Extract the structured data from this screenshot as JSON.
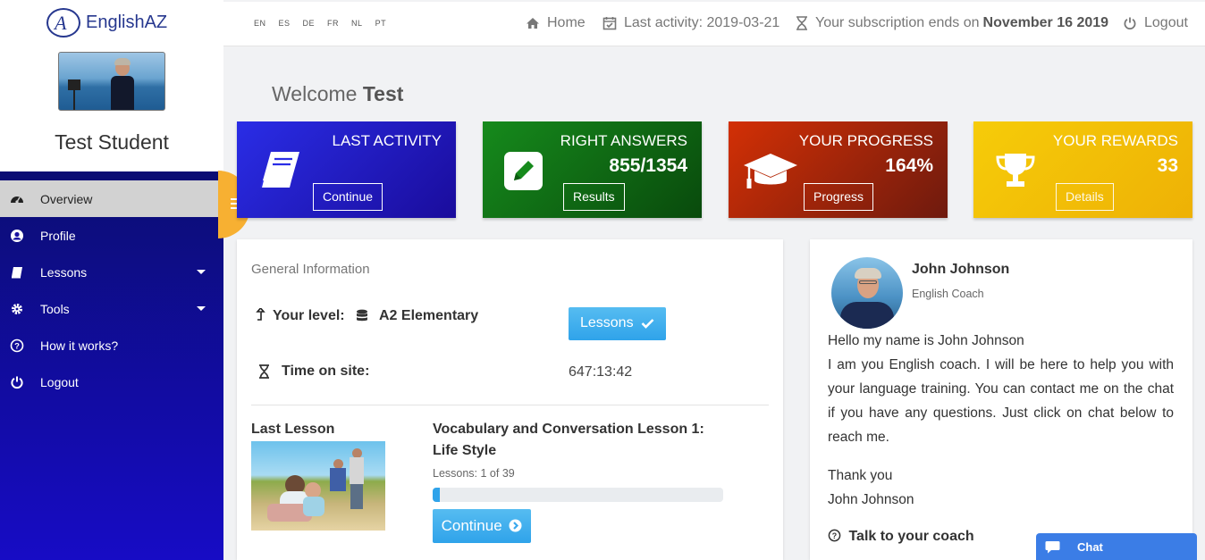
{
  "sidebar": {
    "logo_letter": "A",
    "logo_text": "EnglishAZ",
    "student_name": "Test Student",
    "items": [
      {
        "label": "Overview",
        "icon": "dashboard-icon"
      },
      {
        "label": "Profile",
        "icon": "user-circle-icon"
      },
      {
        "label": "Lessons",
        "icon": "book-icon"
      },
      {
        "label": "Tools",
        "icon": "gear-icon"
      },
      {
        "label": "How it works?",
        "icon": "question-circle-icon"
      },
      {
        "label": "Logout",
        "icon": "power-icon"
      }
    ]
  },
  "header": {
    "languages": [
      "EN",
      "ES",
      "DE",
      "FR",
      "NL",
      "PT"
    ],
    "home_label": "Home",
    "last_activity": "Last activity: 2019-03-21",
    "subscription_prefix": "Your subscription ends on",
    "subscription_date": "November 16 2019",
    "logout_label": "Logout"
  },
  "welcome": {
    "prefix": "Welcome",
    "name": "Test"
  },
  "cards": [
    {
      "title": "LAST ACTIVITY",
      "value": "",
      "button": "Continue",
      "icon": "book-icon",
      "colors": [
        "#2a2de6",
        "#1a0c9c"
      ]
    },
    {
      "title": "RIGHT ANSWERS",
      "value": "855/1354",
      "button": "Results",
      "icon": "pencil-square-icon",
      "colors": [
        "#168a1c",
        "#094a0c"
      ]
    },
    {
      "title": "YOUR PROGRESS",
      "value": "164%",
      "button": "Progress",
      "icon": "graduation-cap-icon",
      "colors": [
        "#d33005",
        "#6e1a0e"
      ]
    },
    {
      "title": "YOUR REWARDS",
      "value": "33",
      "button": "Details",
      "icon": "trophy-icon",
      "colors": [
        "#f6cc09",
        "#eeb105"
      ]
    }
  ],
  "general_info": {
    "title": "General Information",
    "level_label": "Your level:",
    "level_value": "A2 Elementary",
    "lessons_button": "Lessons",
    "time_label": "Time on site:",
    "time_value": "647:13:42",
    "last_lesson_label": "Last Lesson",
    "lesson_title_1": "Vocabulary and Conversation Lesson 1:",
    "lesson_title_2": "Life Style",
    "lesson_count": "Lessons: 1 of 39",
    "progress_fraction": 0.025,
    "continue_button": "Continue"
  },
  "coach": {
    "name": "John Johnson",
    "role": "English Coach",
    "greeting": "Hello my name is John Johnson",
    "message": "I am you English coach. I will be here to help you with your language training. You can contact me on the chat if you have any questions. Just click on chat below to reach me.",
    "thanks": "Thank you",
    "signature": "John Johnson",
    "talk_label": "Talk to your coach"
  },
  "chat": {
    "label": "Chat"
  }
}
